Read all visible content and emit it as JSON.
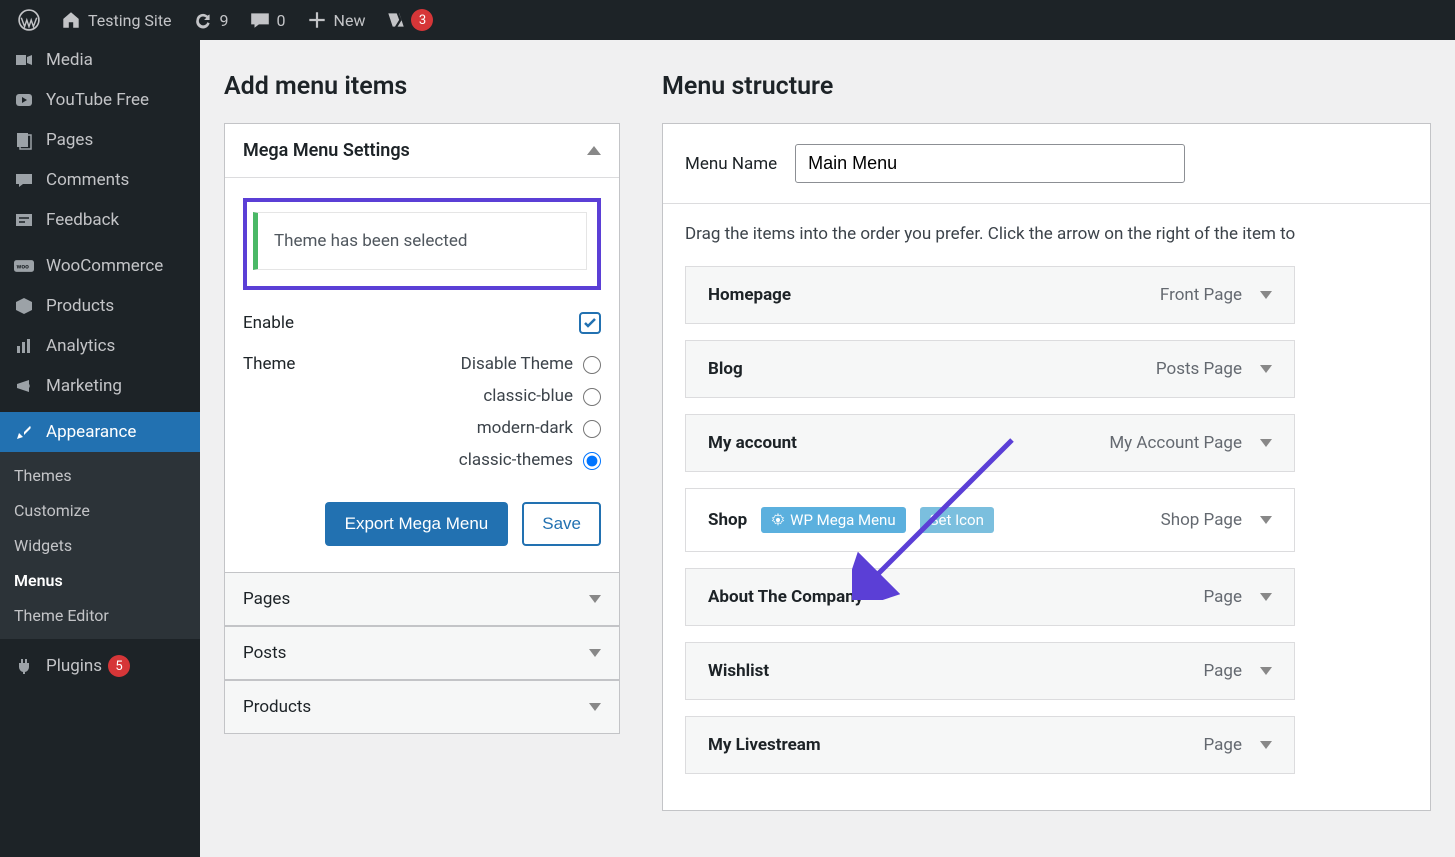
{
  "adminbar": {
    "site_name": "Testing Site",
    "updates_count": "9",
    "comments_count": "0",
    "new_label": "New",
    "yoast_count": "3"
  },
  "sidebar": {
    "items": [
      {
        "label": "Media"
      },
      {
        "label": "YouTube Free"
      },
      {
        "label": "Pages"
      },
      {
        "label": "Comments"
      },
      {
        "label": "Feedback"
      },
      {
        "label": "WooCommerce"
      },
      {
        "label": "Products"
      },
      {
        "label": "Analytics"
      },
      {
        "label": "Marketing"
      },
      {
        "label": "Appearance"
      },
      {
        "label": "Plugins"
      }
    ],
    "appearance_sub": [
      "Themes",
      "Customize",
      "Widgets",
      "Menus",
      "Theme Editor"
    ],
    "plugins_badge": "5"
  },
  "left": {
    "heading": "Add menu items",
    "mega_header": "Mega Menu Settings",
    "notice": "Theme has been selected",
    "enable_label": "Enable",
    "theme_label": "Theme",
    "theme_options": [
      "Disable Theme",
      "classic-blue",
      "modern-dark",
      "classic-themes"
    ],
    "selected_theme": "classic-themes",
    "export_btn": "Export Mega Menu",
    "save_btn": "Save",
    "closed_panels": [
      "Pages",
      "Posts",
      "Products"
    ]
  },
  "right": {
    "heading": "Menu structure",
    "menu_name_label": "Menu Name",
    "menu_name_value": "Main Menu",
    "hint": "Drag the items into the order you prefer. Click the arrow on the right of the item to",
    "wp_mega_label": "WP Mega Menu",
    "set_icon_label": "Set Icon",
    "items": [
      {
        "title": "Homepage",
        "type": "Front Page"
      },
      {
        "title": "Blog",
        "type": "Posts Page"
      },
      {
        "title": "My account",
        "type": "My Account Page"
      },
      {
        "title": "Shop",
        "type": "Shop Page",
        "hover": true
      },
      {
        "title": "About The Company",
        "type": "Page"
      },
      {
        "title": "Wishlist",
        "type": "Page"
      },
      {
        "title": "My Livestream",
        "type": "Page"
      }
    ]
  }
}
